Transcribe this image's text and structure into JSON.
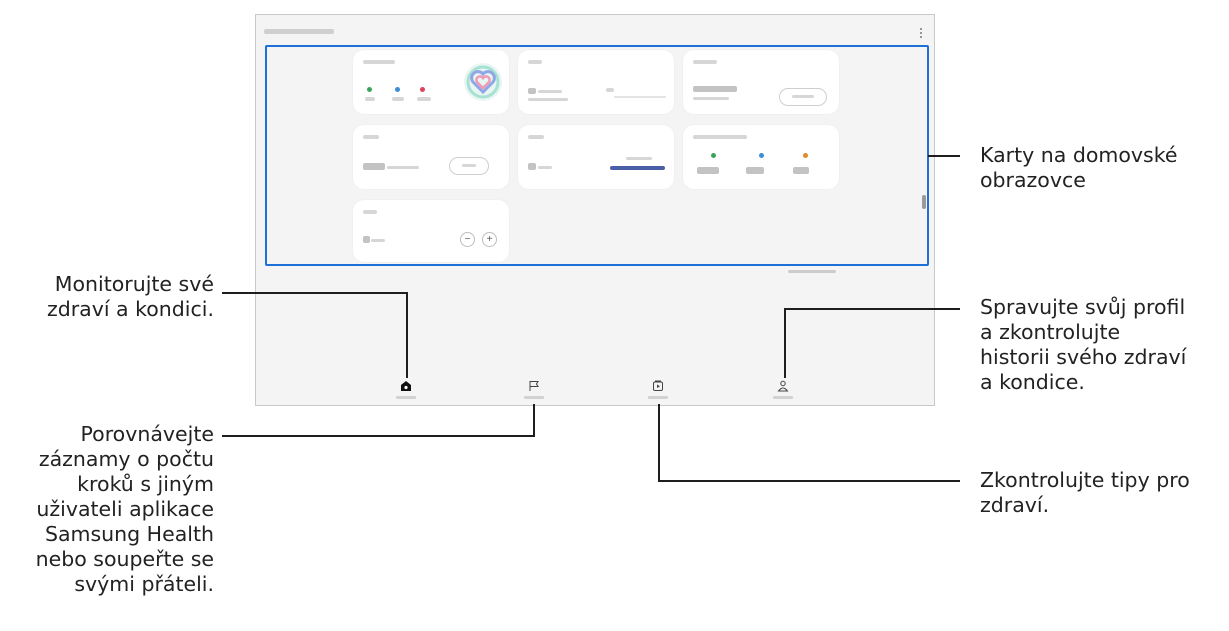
{
  "callouts": {
    "cards": [
      "Karty na domovské",
      "obrazovce"
    ],
    "home": [
      "Monitorujte své",
      "zdraví a kondici."
    ],
    "together": [
      "Porovnávejte",
      "záznamy o počtu",
      "kroků s jiným",
      "uživateli aplikace",
      "Samsung Health",
      "nebo soupeřte se",
      "svými přáteli."
    ],
    "profile": [
      "Spravujte svůj profil",
      "a zkontrolujte",
      "historii svého zdraví",
      "a kondice."
    ],
    "discover": [
      "Zkontrolujte tipy pro",
      "zdraví."
    ]
  },
  "colors": {
    "highlight": "#1f6fd8",
    "screen_bg": "#f4f4f4",
    "card_bg": "#ffffff",
    "progress_bar": "#4a5fa8"
  },
  "screen": {
    "more_icon": "more-vertical-icon",
    "nav": [
      {
        "icon": "home-icon",
        "active": true
      },
      {
        "icon": "flag-icon",
        "active": false
      },
      {
        "icon": "play-card-icon",
        "active": false
      },
      {
        "icon": "person-icon",
        "active": false
      }
    ]
  }
}
